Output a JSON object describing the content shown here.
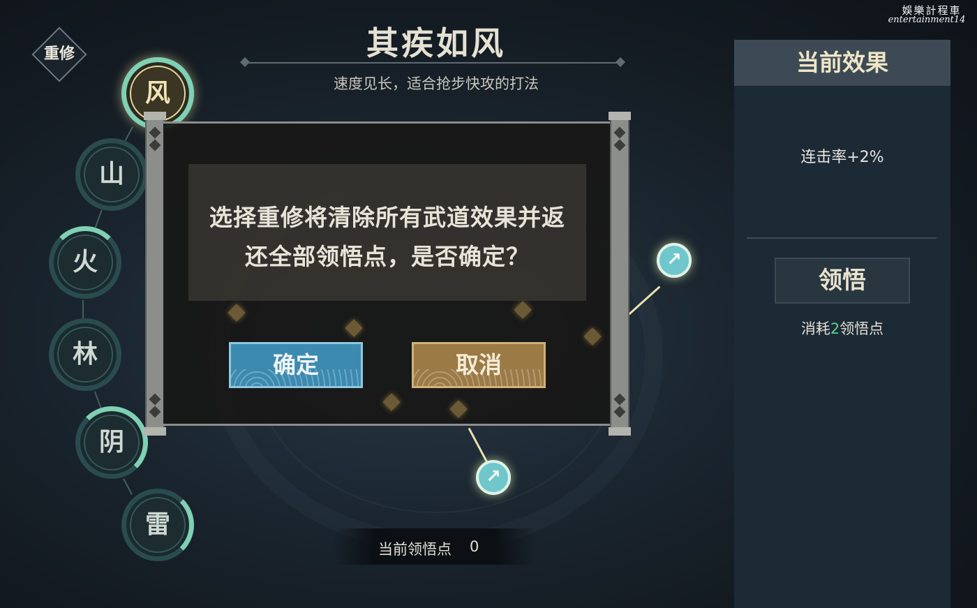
{
  "watermark": {
    "line1": "娛樂計程車",
    "line2": "entertainment14"
  },
  "reset_button": {
    "label": "重修"
  },
  "header": {
    "title": "其疾如风",
    "subtitle": "速度见长，适合抢步快攻的打法"
  },
  "element_nodes": [
    {
      "label": "风",
      "active": true
    },
    {
      "label": "山",
      "active": false
    },
    {
      "label": "火",
      "active": false
    },
    {
      "label": "林",
      "active": false
    },
    {
      "label": "阴",
      "active": false
    },
    {
      "label": "雷",
      "active": false
    }
  ],
  "dialog": {
    "message_line1": "选择重修将清除所有武道效果并返",
    "message_line2": "还全部领悟点，是否确定？",
    "confirm_label": "确定",
    "cancel_label": "取消"
  },
  "right_panel": {
    "header": "当前效果",
    "effect": "连击率+2%",
    "comprehend_label": "领悟",
    "cost_prefix": "消耗",
    "cost_value": "2",
    "cost_suffix": "领悟点"
  },
  "points": {
    "label": "当前领悟点",
    "value": "0"
  },
  "colors": {
    "confirm": "#3c8ab0",
    "cancel": "#9b7a45",
    "accent_teal": "#7fd0b5",
    "cost_green": "#5ed28b"
  },
  "icons": {
    "skill_node": "sword-arrow-icon"
  }
}
